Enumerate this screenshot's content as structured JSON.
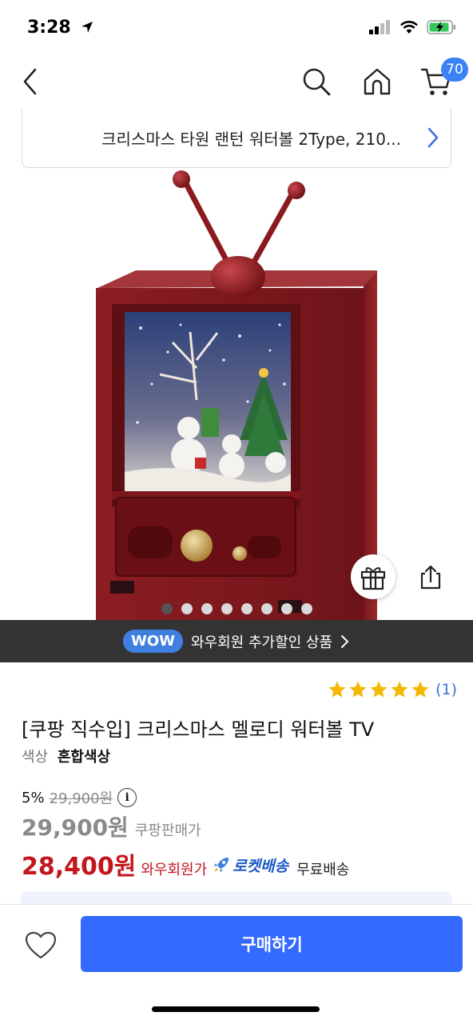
{
  "status": {
    "time": "3:28"
  },
  "nav": {
    "cart_count": "70",
    "back_icon": "chevron-left-icon",
    "search_icon": "search-icon",
    "home_icon": "home-icon",
    "cart_icon": "cart-icon"
  },
  "breadcrumb": {
    "text": "크리스마스 타원 랜턴 워터볼 2Type, 210..."
  },
  "carousel": {
    "total": 8,
    "active": 0
  },
  "wow_banner": {
    "pill": "WOW",
    "text": "와우회원 추가할인 상품"
  },
  "product": {
    "rating_stars": 5,
    "review_count": "(1)",
    "title": "[쿠팡 직수입] 크리스마스 멜로디 워터볼 TV",
    "option_label": "색상",
    "option_value": "혼합색상",
    "discount": "5%",
    "original_price": "29,900원",
    "seller_price": "29,900원",
    "seller_price_label": "쿠팡판매가",
    "wow_price": "28,400원",
    "wow_price_label": "와우회원가",
    "rocket_label": "로켓배송",
    "free_shipping": "무료배송"
  },
  "bottom": {
    "buy_label": "구매하기"
  },
  "colors": {
    "accent": "#346aff",
    "wow_price": "#c4151c",
    "badge": "#3b82f6",
    "star": "#f5b800",
    "banner_bg": "#333333"
  }
}
